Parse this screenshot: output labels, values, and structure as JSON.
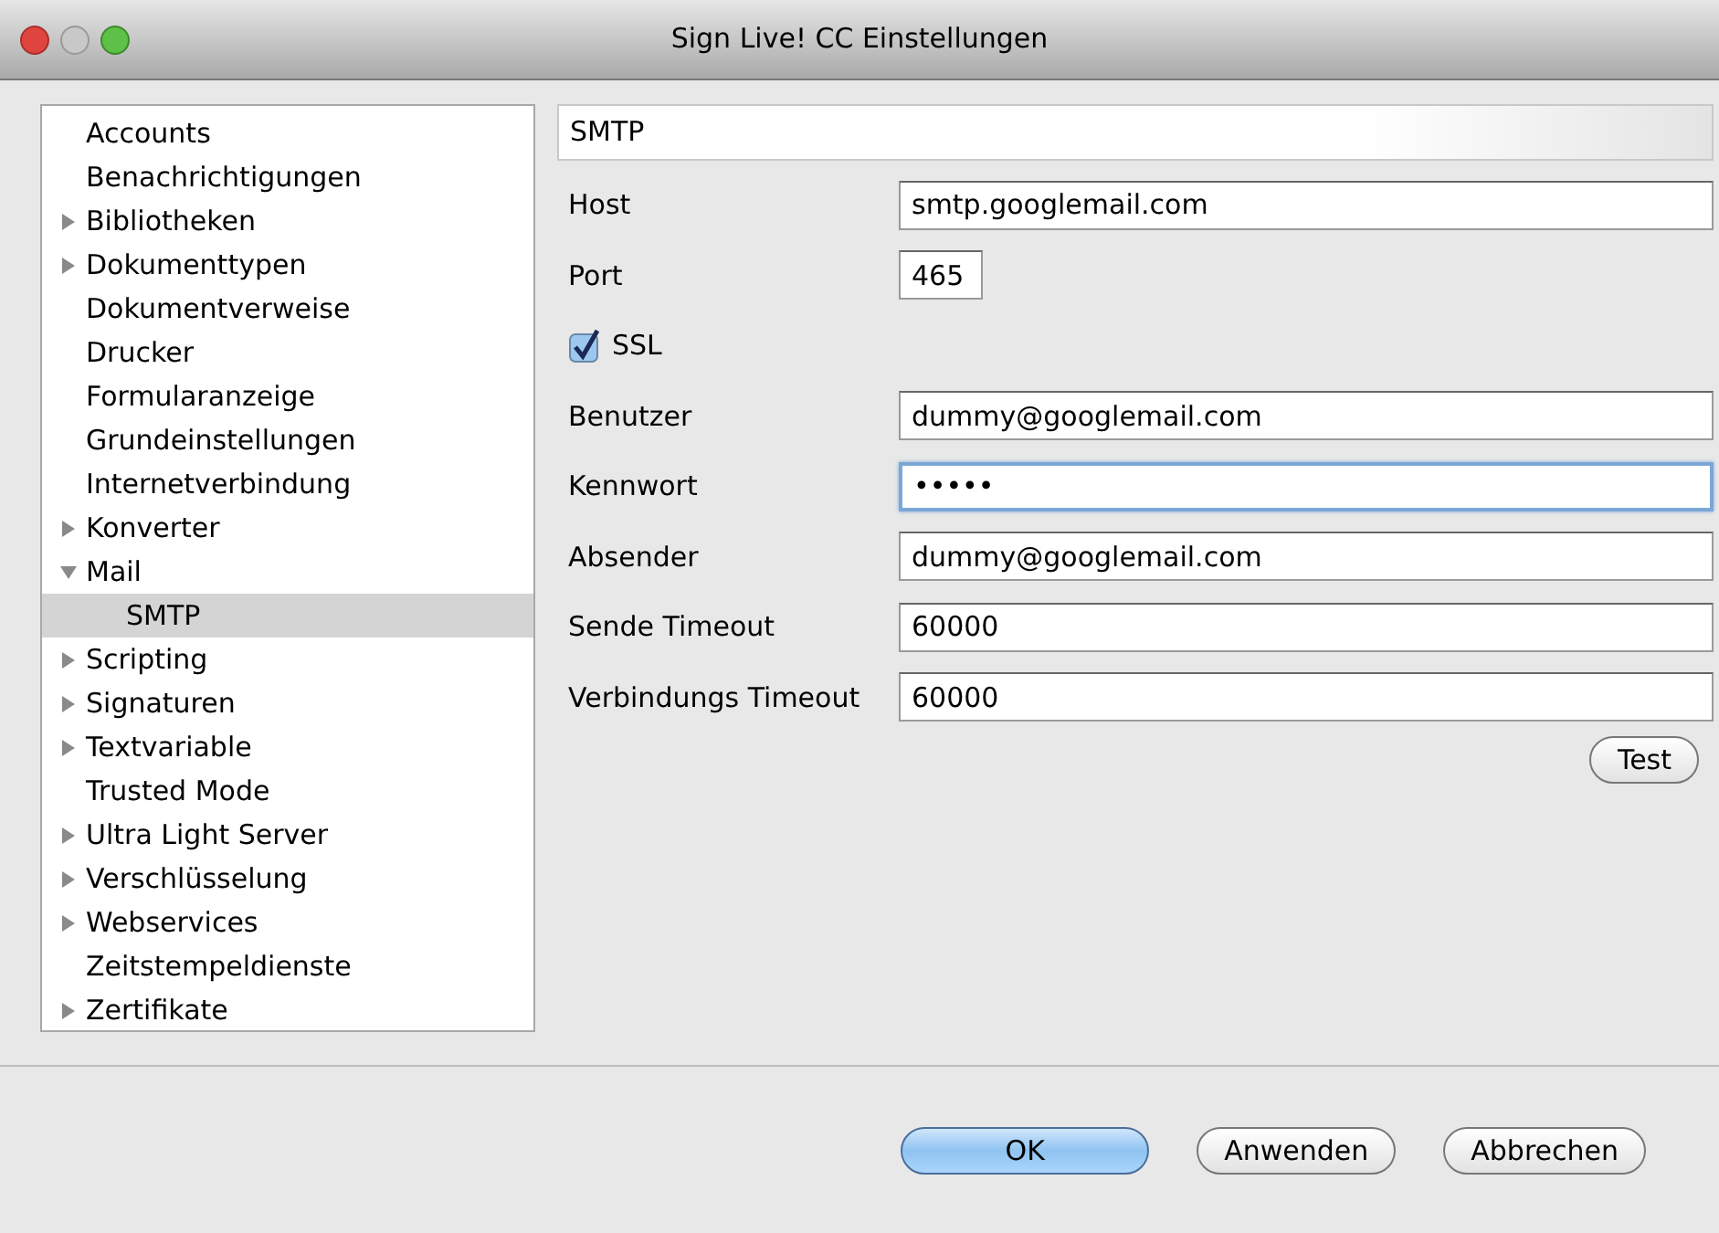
{
  "window": {
    "title": "Sign Live! CC Einstellungen"
  },
  "tree": {
    "items": [
      {
        "label": "Accounts",
        "selected": false
      },
      {
        "label": "Benachrichtigungen",
        "selected": false
      },
      {
        "label": "Bibliotheken",
        "expanded": false,
        "selected": false
      },
      {
        "label": "Dokumenttypen",
        "expanded": false,
        "selected": false
      },
      {
        "label": "Dokumentverweise",
        "selected": false
      },
      {
        "label": "Drucker",
        "selected": false
      },
      {
        "label": "Formularanzeige",
        "selected": false
      },
      {
        "label": "Grundeinstellungen",
        "selected": false
      },
      {
        "label": "Internetverbindung",
        "selected": false
      },
      {
        "label": "Konverter",
        "expanded": false,
        "selected": false
      },
      {
        "label": "Mail",
        "expanded": true,
        "selected": false,
        "children": [
          {
            "label": "SMTP",
            "selected": true
          }
        ]
      },
      {
        "label": "Scripting",
        "expanded": false,
        "selected": false
      },
      {
        "label": "Signaturen",
        "expanded": false,
        "selected": false
      },
      {
        "label": "Textvariable",
        "expanded": false,
        "selected": false
      },
      {
        "label": "Trusted Mode",
        "selected": false
      },
      {
        "label": "Ultra Light Server",
        "expanded": false,
        "selected": false
      },
      {
        "label": "Verschlüsselung",
        "expanded": false,
        "selected": false
      },
      {
        "label": "Webservices",
        "expanded": false,
        "selected": false
      },
      {
        "label": "Zeitstempeldienste",
        "selected": false
      },
      {
        "label": "Zertifikate",
        "expanded": false,
        "selected": false
      }
    ]
  },
  "panel": {
    "title": "SMTP",
    "fields": [
      {
        "kind": "text",
        "label": "Host",
        "value": "smtp.googlemail.com",
        "focused": false
      },
      {
        "kind": "short",
        "label": "Port",
        "value": "465",
        "focused": false
      },
      {
        "kind": "checkbox",
        "label": "SSL",
        "checked": true
      },
      {
        "kind": "text",
        "label": "Benutzer",
        "value": "dummy@googlemail.com",
        "focused": false
      },
      {
        "kind": "text",
        "label": "Kennwort",
        "value": "•••••",
        "focused": true
      },
      {
        "kind": "text",
        "label": "Absender",
        "value": "dummy@googlemail.com",
        "focused": false
      },
      {
        "kind": "text",
        "label": "Sende Timeout",
        "value": "60000",
        "focused": false
      },
      {
        "kind": "text",
        "label": "Verbindungs Timeout",
        "value": "60000",
        "focused": false
      }
    ],
    "test_button": "Test"
  },
  "buttons": [
    {
      "label": "OK",
      "default": true
    },
    {
      "label": "Anwenden",
      "default": false
    },
    {
      "label": "Abbrechen",
      "default": false
    }
  ]
}
